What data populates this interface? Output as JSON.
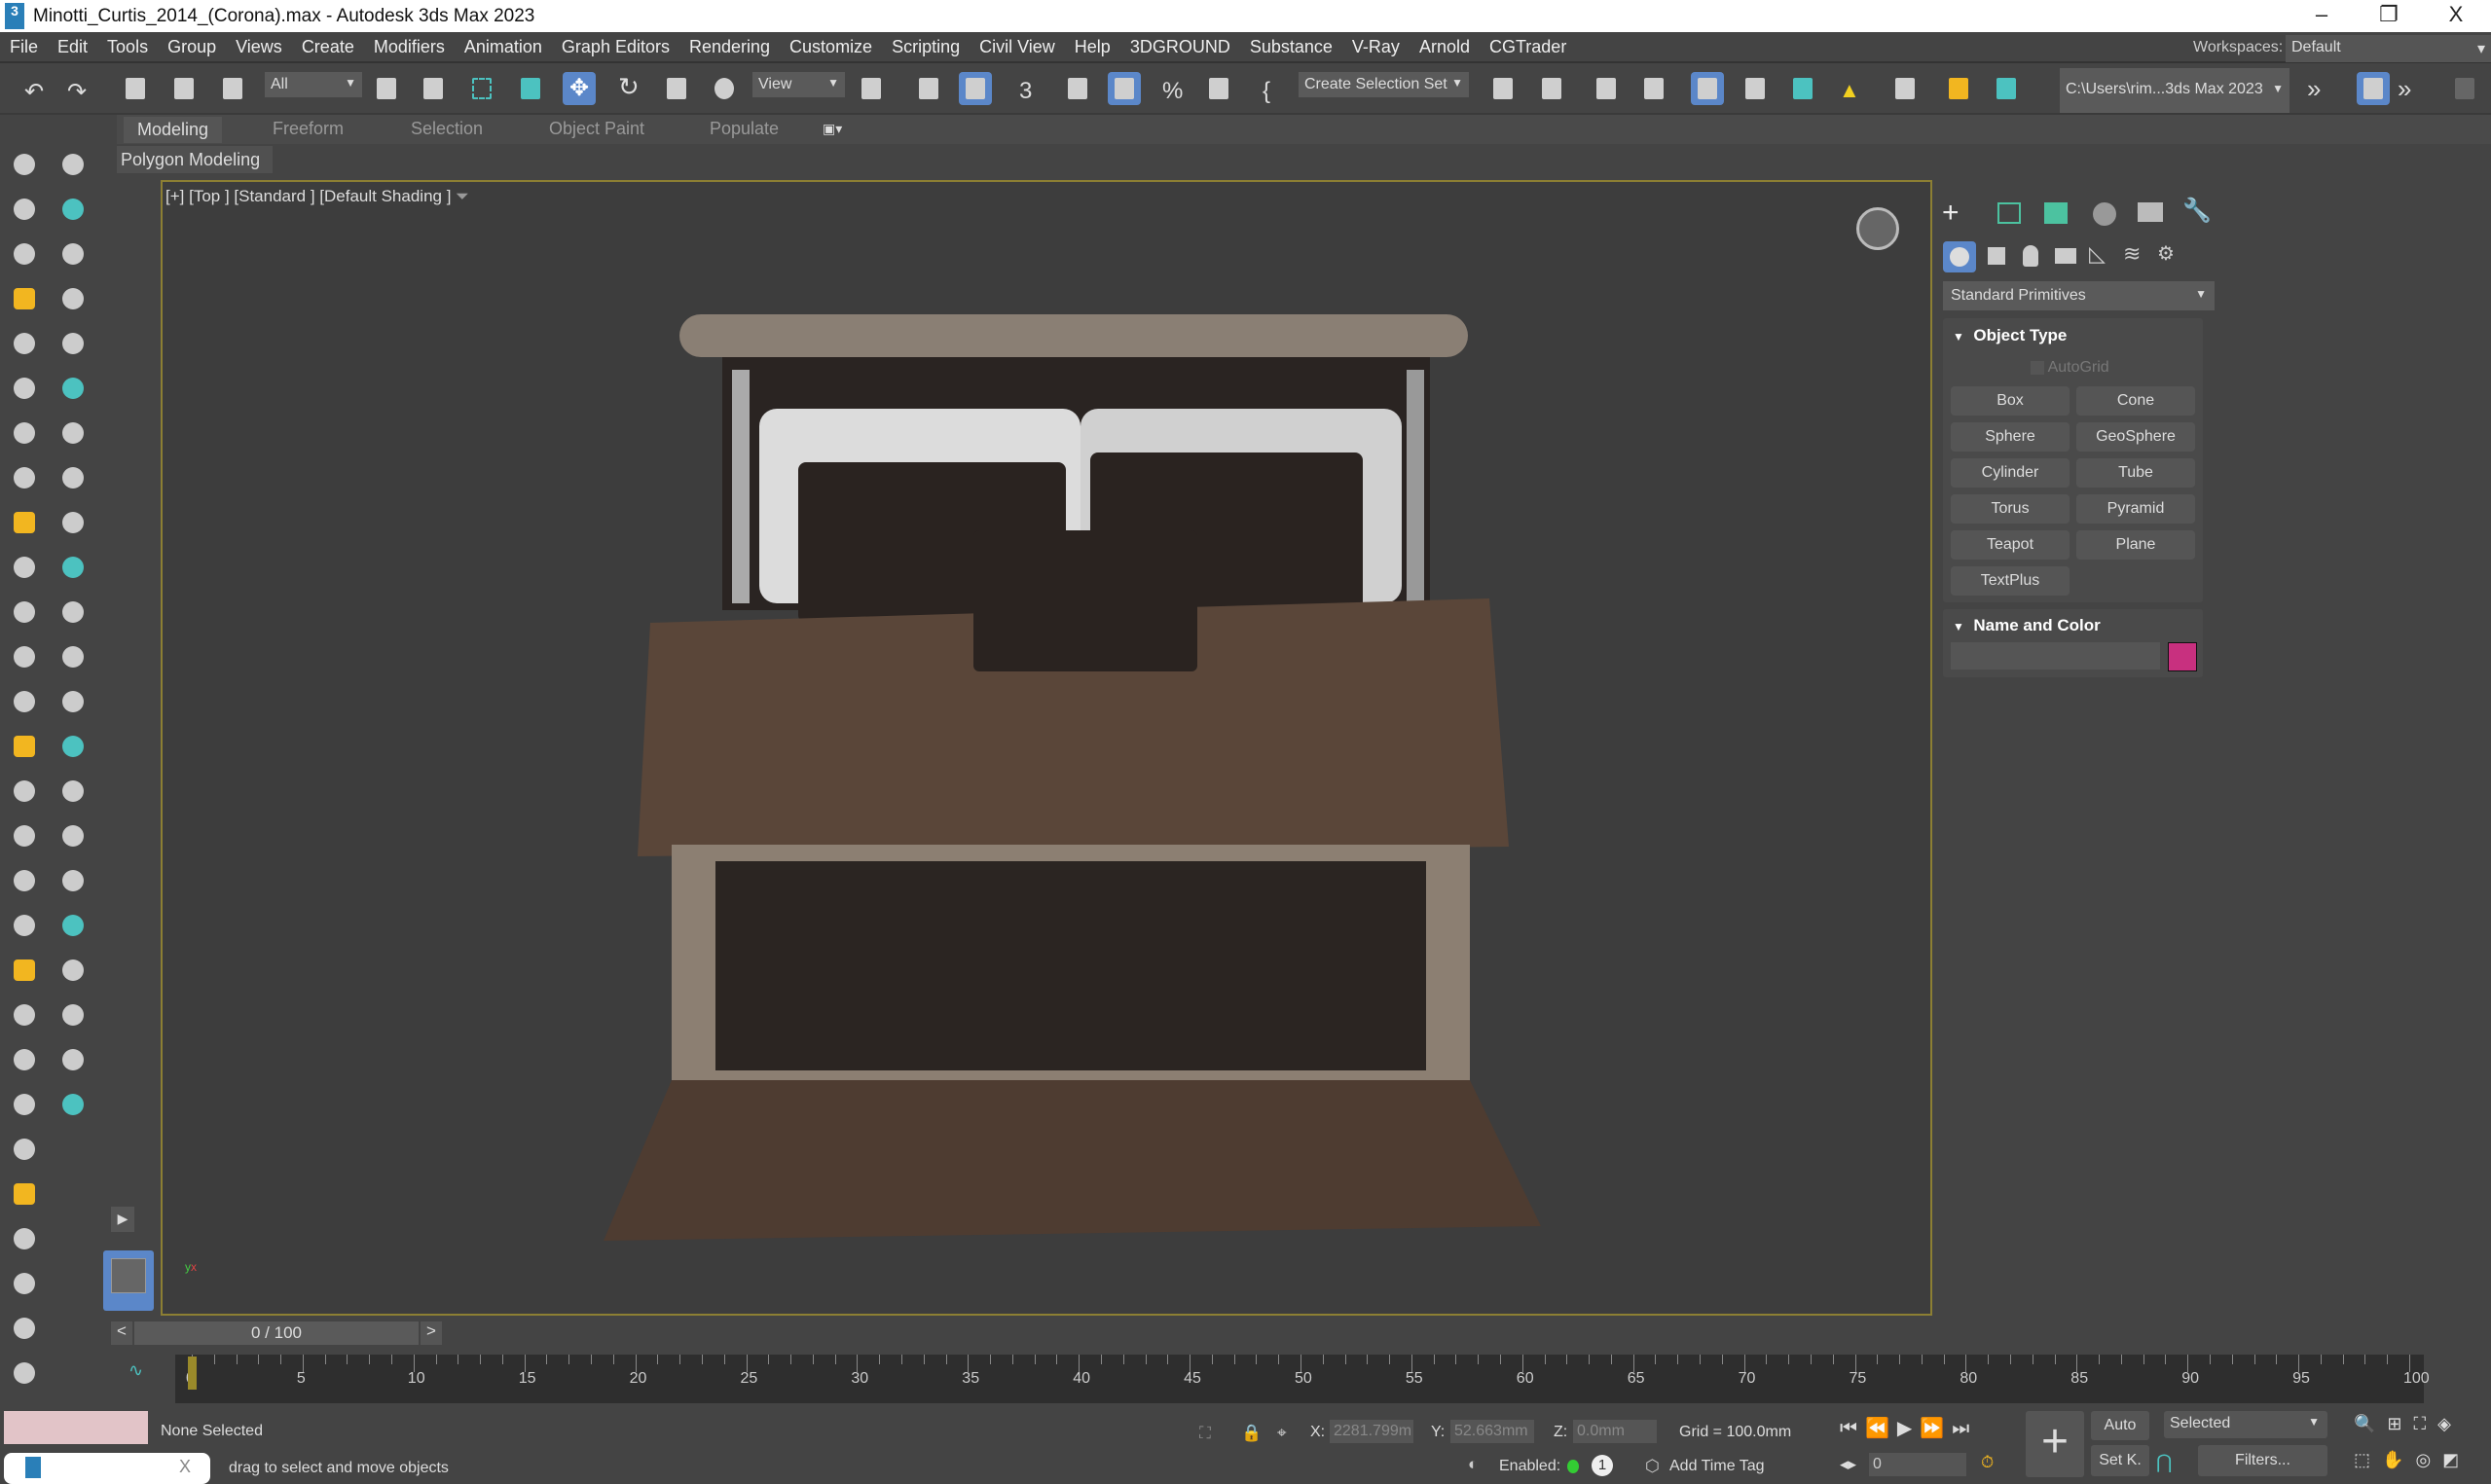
{
  "window": {
    "title": "Minotti_Curtis_2014_(Corona).max - Autodesk 3ds Max 2023",
    "app_icon": "3",
    "minimize": "–",
    "restore": "❐",
    "close": "X"
  },
  "menu": [
    "File",
    "Edit",
    "Tools",
    "Group",
    "Views",
    "Create",
    "Modifiers",
    "Animation",
    "Graph Editors",
    "Rendering",
    "Customize",
    "Scripting",
    "Civil View",
    "Help",
    "3DGROUND",
    "Substance",
    "V-Ray",
    "Arnold",
    "CGTrader"
  ],
  "workspaces": {
    "label": "Workspaces:",
    "value": "Default"
  },
  "toolbar": {
    "selection_filter": "All",
    "ref_coord": "View",
    "selection_set": "Create Selection Set",
    "project_path": "C:\\Users\\rim...3ds Max 2023",
    "more": "»"
  },
  "ribbon": {
    "tabs": [
      "Modeling",
      "Freeform",
      "Selection",
      "Object Paint",
      "Populate"
    ],
    "active_panel": "Polygon Modeling"
  },
  "viewport": {
    "label": "[+] [Top ] [Standard ] [Default Shading ]"
  },
  "command_panel": {
    "category": "Standard Primitives",
    "object_type_title": "Object Type",
    "autogrid": "AutoGrid",
    "buttons": [
      "Box",
      "Cone",
      "Sphere",
      "GeoSphere",
      "Cylinder",
      "Tube",
      "Torus",
      "Pyramid",
      "Teapot",
      "Plane",
      "TextPlus"
    ],
    "name_color_title": "Name and Color",
    "object_color": "#c8307f"
  },
  "timeslider": {
    "value": "0 / 100",
    "prev": "<",
    "next": ">"
  },
  "trackbar": {
    "ticks": [
      "0",
      "5",
      "10",
      "15",
      "20",
      "25",
      "30",
      "35",
      "40",
      "45",
      "50",
      "55",
      "60",
      "65",
      "70",
      "75",
      "80",
      "85",
      "90",
      "95",
      "100"
    ]
  },
  "status": {
    "selection": "None Selected",
    "prompt": "drag to select and move objects",
    "x_label": "X:",
    "x": "2281.799m",
    "y_label": "Y:",
    "y": "52.663mm",
    "z_label": "Z:",
    "z": "0.0mm",
    "grid": "Grid = 100.0mm",
    "enabled": "Enabled:",
    "enabled_count": "1",
    "add_time_tag": "Add Time Tag",
    "frame": "0",
    "auto": "Auto",
    "set_key": "Set K.",
    "key_mode": "Selected",
    "filters": "Filters..."
  },
  "colors": {
    "accent": "#5b87c9",
    "viewport_border": "#8c7f33"
  }
}
